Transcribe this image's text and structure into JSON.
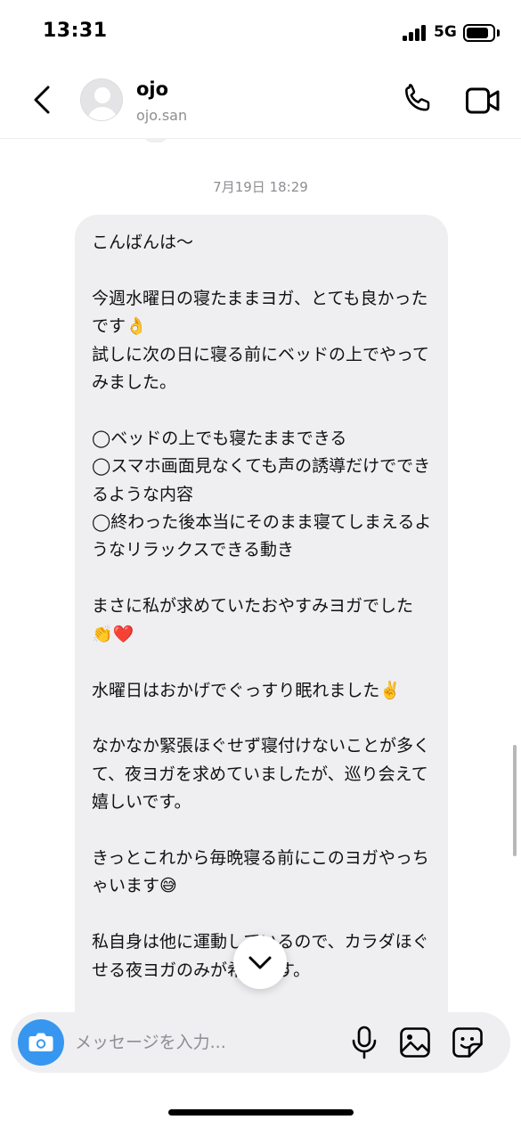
{
  "status_bar": {
    "time": "13:31",
    "network": "5G"
  },
  "header": {
    "name": "ojo",
    "username": "ojo.san",
    "icons": [
      "back-chevron-icon",
      "phone-icon",
      "video-camera-icon"
    ]
  },
  "chat": {
    "timestamp": "7月19日 18:29",
    "message": "こんばんは〜\n\n今週水曜日の寝たままヨガ、とても良かったです👌\n試しに次の日に寝る前にベッドの上でやってみました。\n\n◯ベッドの上でも寝たままできる\n◯スマホ画面見なくても声の誘導だけでできるような内容\n◯終わった後本当にそのまま寝てしまえるようなリラックスできる動き\n\nまさに私が求めていたおやすみヨガでした👏❤️\n\n水曜日はおかげでぐっすり眠れました✌️\n\nなかなか緊張ほぐせず寝付けないことが多くて、夜ヨガを求めていましたが、巡り会えて嬉しいです。\n\nきっとこれから毎晩寝る前にこのヨガやっちゃいます😅\n\n私自身は他に運動しているので、カラダほぐせる夜ヨガのみが希望です。"
  },
  "composer": {
    "placeholder": "メッセージを入力...",
    "icons": [
      "camera-icon",
      "microphone-icon",
      "image-icon",
      "sticker-icon"
    ]
  },
  "colors": {
    "accent": "#3797f0",
    "bubble": "#efeff2",
    "secondary_text": "#8e8e93"
  }
}
